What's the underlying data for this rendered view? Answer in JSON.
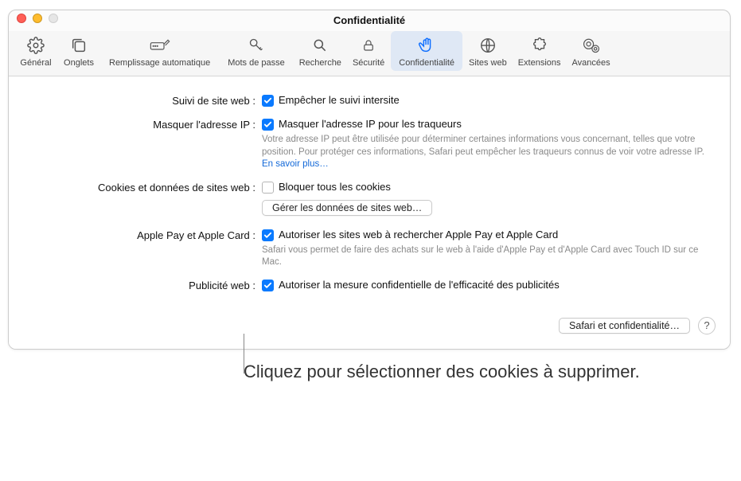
{
  "window": {
    "title": "Confidentialité"
  },
  "toolbar": {
    "general": "Général",
    "tabs": "Onglets",
    "autofill": "Remplissage automatique",
    "passwords": "Mots de passe",
    "search": "Recherche",
    "security": "Sécurité",
    "privacy": "Confidentialité",
    "websites": "Sites web",
    "extensions": "Extensions",
    "advanced": "Avancées"
  },
  "rows": {
    "tracking": {
      "label": "Suivi de site web :",
      "check": "Empêcher le suivi intersite"
    },
    "hideip": {
      "label": "Masquer l'adresse IP :",
      "check": "Masquer l'adresse IP pour les traqueurs",
      "sub": "Votre adresse IP peut être utilisée pour déterminer certaines informations vous concernant, telles que votre position. Pour protéger ces informations, Safari peut empêcher les traqueurs connus de voir votre adresse IP. ",
      "learn": "En savoir plus…"
    },
    "cookies": {
      "label": "Cookies et données de sites web :",
      "check": "Bloquer tous les cookies",
      "button": "Gérer les données de sites web…"
    },
    "applepay": {
      "label": "Apple Pay et Apple Card :",
      "check": "Autoriser les sites web à rechercher Apple Pay et Apple Card",
      "sub": "Safari vous permet de faire des achats sur le web à l'aide d'Apple Pay et d'Apple Card avec Touch ID sur ce Mac."
    },
    "ads": {
      "label": "Publicité web :",
      "check": "Autoriser la mesure confidentielle de l'efficacité des publicités"
    }
  },
  "footer": {
    "about": "Safari et confidentialité…",
    "help": "?"
  },
  "callout": "Cliquez pour sélectionner des cookies à supprimer."
}
